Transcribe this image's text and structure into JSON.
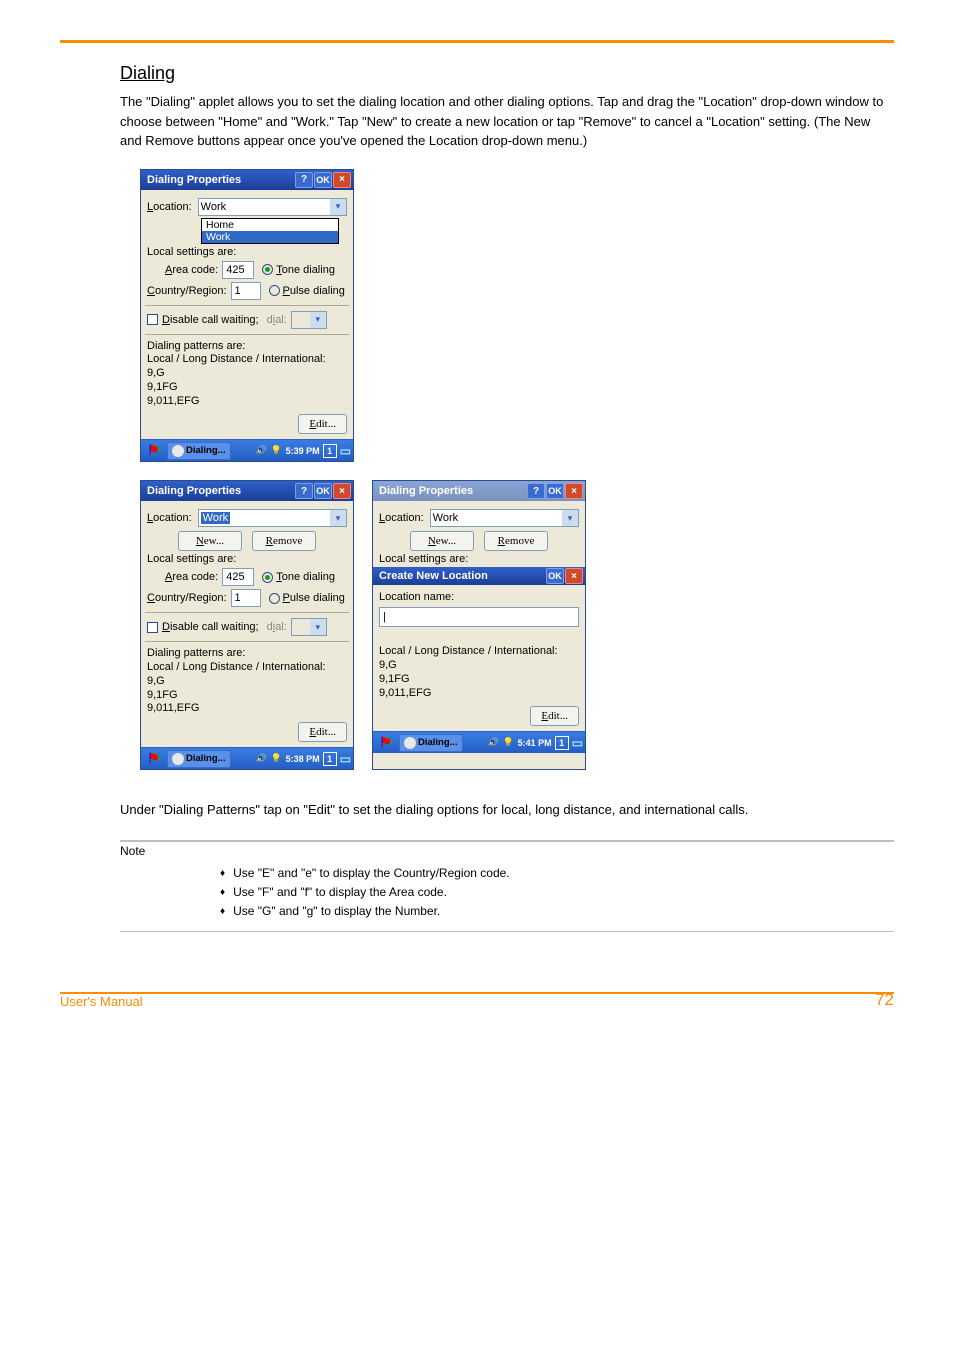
{
  "page": {
    "section_title": "Dialing",
    "intro_para": "The \"Dialing\" applet allows you to set the dialing location and other dialing options. Tap and drag the \"Location\" drop-down window to choose between \"Home\" and \"Work.\" Tap \"New\" to create a new location or tap \"Remove\" to cancel a \"Location\" setting. (The New and Remove buttons appear once you've opened the Location drop-down menu.)",
    "dial_patterns_para": "Under \"Dialing Patterns\" tap on \"Edit\" to set the dialing options for local, long distance, and international calls.",
    "note_line": "Note",
    "note_items": [
      "Use \"E\" and \"e\" to display the Country/Region code.",
      "Use \"F\" and \"f\" to display the Area code.",
      "Use \"G\" and \"g\" to display the Number."
    ],
    "footer_label": "User's Manual",
    "page_number": "72"
  },
  "win_common": {
    "title": "Dialing Properties",
    "help": "?",
    "ok": "OK",
    "close": "×",
    "location_label": "Location:",
    "location_value": "Work",
    "dd_home": "Home",
    "dd_work": "Work",
    "new_btn": "New...",
    "remove_btn": "Remove",
    "local_settings": "Local settings are:",
    "area_code_lbl": "Area code:",
    "area_code_val": "425",
    "tone": "Tone dialing",
    "pulse": "Pulse dialing",
    "country_lbl": "Country/Region:",
    "country_val": "1",
    "disable_cw": "Disable call waiting;",
    "dial_lbl": "dial:",
    "patterns_hdr": "Dialing patterns are:",
    "patterns_sub": "Local / Long Distance / International:",
    "p1": "9,G",
    "p2": "9,1FG",
    "p3": "9,011,EFG",
    "edit_btn": "Edit...",
    "create_loc_title": "Create New Location",
    "loc_name_lbl": "Location name:",
    "task_label": "Dialing...",
    "time1": "5:39 PM",
    "time2": "5:38 PM",
    "time3": "5:41 PM",
    "kb": "1"
  }
}
